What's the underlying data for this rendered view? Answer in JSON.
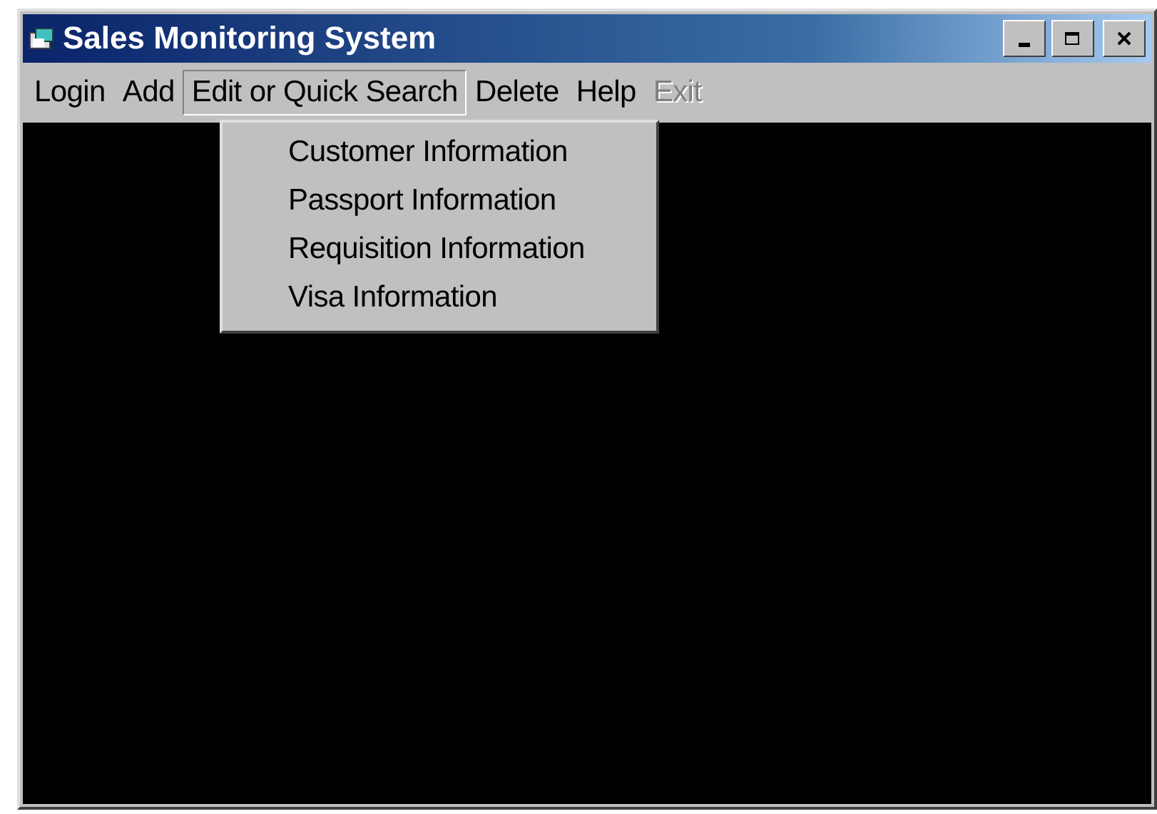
{
  "window": {
    "title": "Sales Monitoring System"
  },
  "menu_bar": [
    {
      "label": "Login",
      "selected": false,
      "disabled": false
    },
    {
      "label": "Add",
      "selected": false,
      "disabled": false
    },
    {
      "label": "Edit or Quick Search",
      "selected": true,
      "disabled": false
    },
    {
      "label": "Delete",
      "selected": false,
      "disabled": false
    },
    {
      "label": "Help",
      "selected": false,
      "disabled": false
    },
    {
      "label": "Exit",
      "selected": false,
      "disabled": true
    }
  ],
  "dropdown_menu": {
    "items": [
      "Customer Information",
      "Passport Information",
      "Requisition Information",
      "Visa Information"
    ]
  }
}
